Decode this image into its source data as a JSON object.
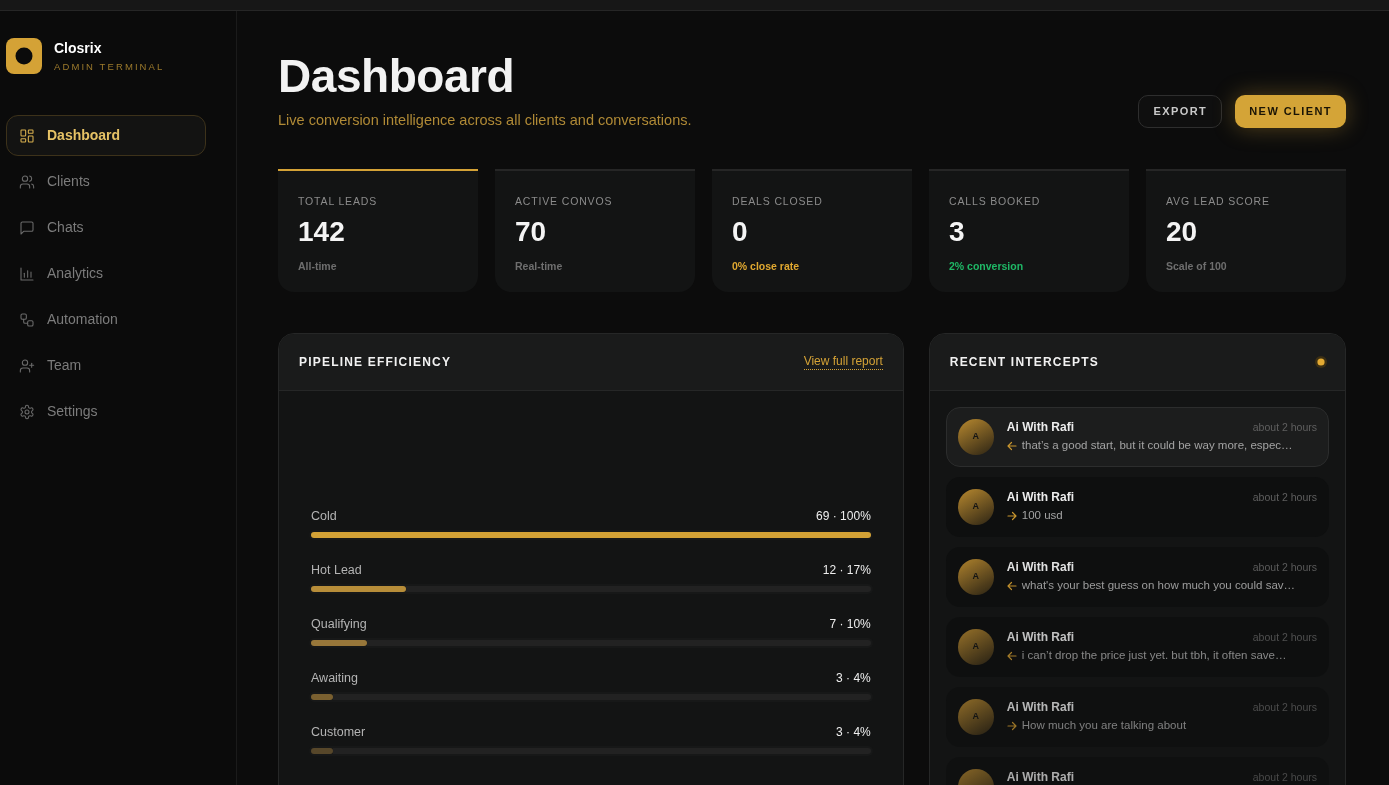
{
  "sidebar": {
    "brand": {
      "name": "Closrix",
      "tagline": "ADMIN TERMINAL"
    },
    "items": [
      {
        "label": "Dashboard",
        "selected": true
      },
      {
        "label": "Clients",
        "selected": false
      },
      {
        "label": "Chats",
        "selected": false
      },
      {
        "label": "Analytics",
        "selected": false
      },
      {
        "label": "Automation",
        "selected": false
      },
      {
        "label": "Team",
        "selected": false
      },
      {
        "label": "Settings",
        "selected": false
      }
    ]
  },
  "header": {
    "title": "Dashboard",
    "subtitle": "Live conversion intelligence across all clients and conversations.",
    "buttons": [
      {
        "label": "EXPORT",
        "kind": "outline"
      },
      {
        "label": "NEW CLIENT",
        "kind": "primary"
      }
    ]
  },
  "stats": [
    {
      "label": "TOTAL LEADS",
      "value": "142",
      "note": {
        "text": "All-time",
        "color": "#6e6e6e"
      },
      "selected": true
    },
    {
      "label": "ACTIVE CONVOS",
      "value": "70",
      "note": {
        "text": "Real-time",
        "color": "#6e6e6e"
      },
      "selected": false
    },
    {
      "label": "DEALS CLOSED",
      "value": "0",
      "note": {
        "text": "0% close rate",
        "color": "#e0a830"
      },
      "selected": false
    },
    {
      "label": "CALLS BOOKED",
      "value": "3",
      "note": {
        "text": "2% conversion",
        "color": "#1fb866"
      },
      "selected": false
    },
    {
      "label": "AVG LEAD SCORE",
      "value": "20",
      "note": {
        "text": "Scale of 100",
        "color": "#6e6e6e"
      },
      "selected": false
    }
  ],
  "pipeline": {
    "title": "PIPELINE EFFICIENCY",
    "link": "View full report",
    "stages": [
      {
        "label": "Cold",
        "reading": "69 · 100%",
        "level": 1,
        "color": "#d4a236"
      },
      {
        "label": "Hot Lead",
        "reading": "12 · 17%",
        "level": 0.17,
        "color": "#b78d39"
      },
      {
        "label": "Qualifying",
        "reading": "7 · 10%",
        "level": 0.1,
        "color": "#98773a"
      },
      {
        "label": "Awaiting",
        "reading": "3 · 4%",
        "level": 0.04,
        "color": "#7a6030"
      },
      {
        "label": "Customer",
        "reading": "3 · 4%",
        "level": 0.04,
        "color": "#57472a"
      }
    ]
  },
  "intercepts": {
    "title": "RECENT INTERCEPTS",
    "items": [
      {
        "initial": "A",
        "name": "Ai With Rafi",
        "time": "about 2 hours",
        "kind": "incoming",
        "message": "that’s a good start, but it could be way more, espec…",
        "selected": true
      },
      {
        "initial": "A",
        "name": "Ai With Rafi",
        "time": "about 2 hours",
        "kind": "outgoing",
        "message": "100 usd",
        "selected": false
      },
      {
        "initial": "A",
        "name": "Ai With Rafi",
        "time": "about 2 hours",
        "kind": "incoming",
        "message": "what's your best guess on how much you could sav…",
        "selected": false
      },
      {
        "initial": "A",
        "name": "Ai With Rafi",
        "time": "about 2 hours",
        "kind": "incoming",
        "message": "i can’t drop the price just yet. but tbh, it often save…",
        "selected": false
      },
      {
        "initial": "A",
        "name": "Ai With Rafi",
        "time": "about 2 hours",
        "kind": "outgoing",
        "message": "How much you are talking about",
        "selected": false
      },
      {
        "name": "Ai With Rafi",
        "time": "about 2 hours",
        "selected": false
      }
    ]
  }
}
